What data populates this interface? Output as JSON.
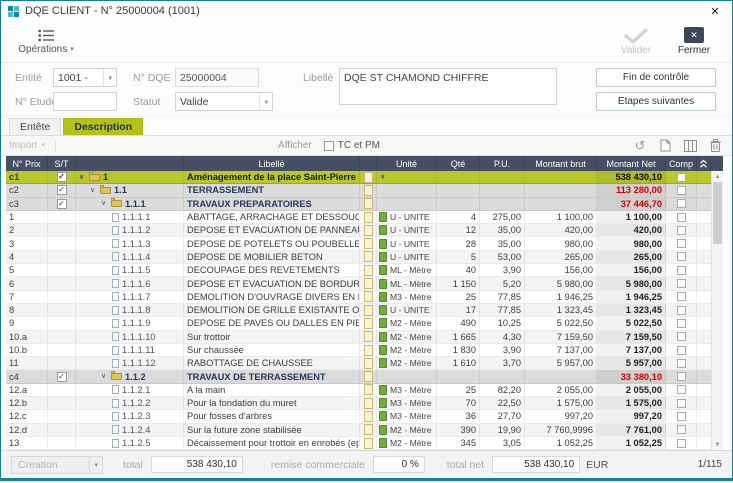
{
  "window": {
    "title": "DQE CLIENT - N° 25000004 (1001)"
  },
  "icons": {
    "close": "✕",
    "caret": "▾",
    "check": "✓",
    "chevron": "∨",
    "undo": "↺",
    "scroll_up": "▲",
    "scroll_down": "▼"
  },
  "colors": {
    "accent_green": "#b9c72c",
    "tab_green": "#b5c018",
    "header_bg": "#454f63",
    "section_navy": "#27355f",
    "amount_red": "#d40000",
    "window_teal": "#0f8296"
  },
  "toolbar": {
    "operations": "Opérations",
    "valider": "Valider",
    "fermer": "Fermer"
  },
  "form": {
    "entite_label": "Entité",
    "entite_value": "1001 -",
    "num_dqe_label": "N° DQE",
    "num_dqe_value": "25000004",
    "libelle_label": "Libellé",
    "libelle_value": "DQE ST CHAMOND CHIFFRE",
    "num_etude_label": "N° Etude",
    "num_etude_value": "",
    "statut_label": "Statut",
    "statut_value": "Valide",
    "fin_controle": "Fin de contrôle",
    "etapes_suivantes": "Etapes suivantes"
  },
  "tabs": [
    {
      "label": "Entête",
      "active": false
    },
    {
      "label": "Description",
      "active": true
    }
  ],
  "grid_toolbar": {
    "import": "Import",
    "afficher": "Afficher",
    "tc_pm": "TC et PM"
  },
  "table": {
    "columns": [
      "N° Prix",
      "S/T",
      "",
      "Libellé",
      "",
      "Unité",
      "Qté",
      "P.U.",
      "Montant brut",
      "Montant Net",
      "Comp"
    ],
    "rows": [
      {
        "num": "c1",
        "type": "root",
        "level": 0,
        "code": "1",
        "label": "Aménagement de la place Saint-Pierre",
        "st": true,
        "unit": "",
        "qty": "",
        "pu": "",
        "brut": "",
        "net": "538 430,10"
      },
      {
        "num": "c2",
        "type": "section",
        "level": 1,
        "code": "1.1",
        "label": "TERRASSEMENT",
        "st": true,
        "net": "113 280,00"
      },
      {
        "num": "c3",
        "type": "section",
        "level": 2,
        "code": "1.1.1",
        "label": "TRAVAUX PREPARATOIRES",
        "st": true,
        "net": "37 446,70"
      },
      {
        "num": "1",
        "type": "leaf",
        "level": 3,
        "code": "1.1.1.1",
        "label": "ABATTAGE, ARRACHAGE ET DESSOUCHAGE D'ARBRES",
        "unit": "U - UNITE",
        "qty": "4",
        "pu": "275,00",
        "brut": "1 100,00",
        "net": "1 100,00"
      },
      {
        "num": "2",
        "type": "leaf",
        "level": 3,
        "code": "1.1.1.2",
        "label": "DEPOSE ET EVACUATION DE PANNEAUX",
        "unit": "U - UNITE",
        "qty": "12",
        "pu": "35,00",
        "brut": "420,00",
        "net": "420,00"
      },
      {
        "num": "3",
        "type": "leaf",
        "level": 3,
        "code": "1.1.1.3",
        "label": "DEPOSE DE POTELETS OU POUBELLES",
        "unit": "U - UNITE",
        "qty": "28",
        "pu": "35,00",
        "brut": "980,00",
        "net": "980,00"
      },
      {
        "num": "4",
        "type": "leaf",
        "level": 3,
        "code": "1.1.1.4",
        "label": "DEPOSE DE MOBILIER BETON",
        "unit": "U - UNITE",
        "qty": "5",
        "pu": "53,00",
        "brut": "265,00",
        "net": "265,00"
      },
      {
        "num": "5",
        "type": "leaf",
        "level": 3,
        "code": "1.1.1.5",
        "label": "DECOUPAGE DES REVETEMENTS",
        "unit": "ML - Mètre",
        "qty": "40",
        "pu": "3,90",
        "brut": "156,00",
        "net": "156,00"
      },
      {
        "num": "6",
        "type": "leaf",
        "level": 3,
        "code": "1.1.1.6",
        "label": "DEPOSE ET EVACUATION DE BORDURES OU DE",
        "unit": "ML - Mètre",
        "qty": "1 150",
        "pu": "5,20",
        "brut": "5 980,00",
        "net": "5 980,00"
      },
      {
        "num": "7",
        "type": "leaf",
        "level": 3,
        "code": "1.1.1.7",
        "label": "DEMOLITION D'OUVRAGE DIVERS EN BETON",
        "unit": "M3 - Mètre",
        "qty": "25",
        "pu": "77,85",
        "brut": "1 946,25",
        "net": "1 946,25"
      },
      {
        "num": "8",
        "type": "leaf",
        "level": 3,
        "code": "1.1.1.8",
        "label": "DEMOLITION DE GRILLE EXISTANTE OU AVALOIR",
        "unit": "U - UNITE",
        "qty": "17",
        "pu": "77,85",
        "brut": "1 323,45",
        "net": "1 323,45"
      },
      {
        "num": "9",
        "type": "leaf",
        "level": 3,
        "code": "1.1.1.9",
        "label": "DEPOSE DE PAVES OU DALLES EN PIERRE OU EN",
        "unit": "M2 - Mètre",
        "qty": "490",
        "pu": "10,25",
        "brut": "5 022,50",
        "net": "5 022,50"
      },
      {
        "num": "10.a",
        "type": "leaf",
        "level": 3,
        "code": "1.1.1.10",
        "label": "Sur trottoir",
        "unit": "M2 - Mètre",
        "qty": "1 665",
        "pu": "4,30",
        "brut": "7 159,50",
        "net": "7 159,50"
      },
      {
        "num": "10.b",
        "type": "leaf",
        "level": 3,
        "code": "1.1.1.11",
        "label": "Sur chaussée",
        "unit": "M2 - Mètre",
        "qty": "1 830",
        "pu": "3,90",
        "brut": "7 137,00",
        "net": "7 137,00"
      },
      {
        "num": "11",
        "type": "leaf",
        "level": 3,
        "code": "1.1.1.12",
        "label": "RABOTTAGE DE CHAUSSEE",
        "unit": "M2 - Mètre",
        "qty": "1 610",
        "pu": "3,70",
        "brut": "5 957,00",
        "net": "5 957,00"
      },
      {
        "num": "c4",
        "type": "section",
        "level": 2,
        "code": "1.1.2",
        "label": "TRAVAUX DE TERRASSEMENT",
        "st": true,
        "net": "33 380,10"
      },
      {
        "num": "12.a",
        "type": "leaf",
        "level": 3,
        "code": "1.1.2.1",
        "label": "A la main",
        "unit": "M3 - Mètre",
        "qty": "25",
        "pu": "82,20",
        "brut": "2 055,00",
        "net": "2 055,00"
      },
      {
        "num": "12.b",
        "type": "leaf",
        "level": 3,
        "code": "1.1.2.2",
        "label": "Pour la fondation du muret",
        "unit": "M3 - Mètre",
        "qty": "70",
        "pu": "22,50",
        "brut": "1 575,00",
        "net": "1 575,00"
      },
      {
        "num": "12.c",
        "type": "leaf",
        "level": 3,
        "code": "1.1.2.3",
        "label": "Pour fosses d'arbres",
        "unit": "M3 - Mètre",
        "qty": "36",
        "pu": "27,70",
        "brut": "997,20",
        "net": "997,20"
      },
      {
        "num": "12.d",
        "type": "leaf",
        "level": 3,
        "code": "1.1.2.4",
        "label": "Sur la future zone stabilisée",
        "unit": "M2 - Mètre",
        "qty": "390",
        "pu": "19,90",
        "brut": "7 760,9996",
        "net": "7 761,00"
      },
      {
        "num": "13",
        "type": "leaf",
        "level": 3,
        "code": "1.1.2.5",
        "label": "Décaissement pour trottoir en enrobés (ep moyen)",
        "unit": "M2 - Mètre",
        "qty": "345",
        "pu": "3,05",
        "brut": "1 052,25",
        "net": "1 052,25"
      }
    ]
  },
  "footer": {
    "creation": "Creation",
    "total_label": "total",
    "total_value": "538 430,10",
    "remise_label": "remise commerciale",
    "remise_value": "0 %",
    "total_net_label": "total net",
    "total_net_value": "538 430,10",
    "currency": "EUR",
    "page": "1/115"
  }
}
